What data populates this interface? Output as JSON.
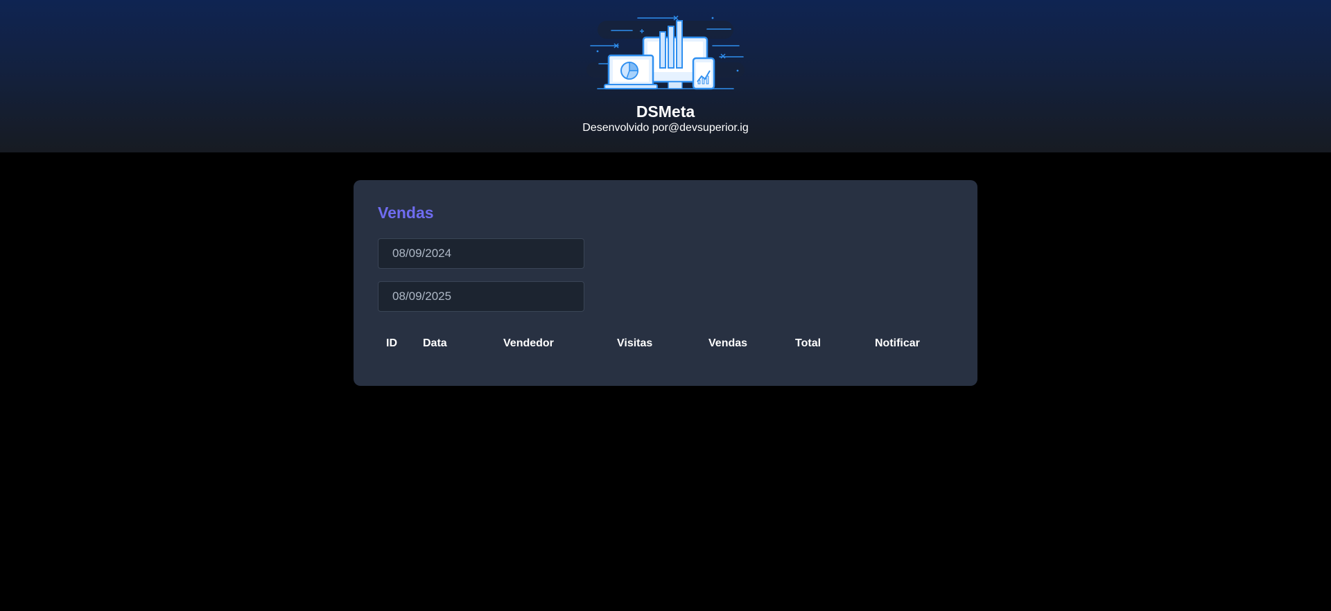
{
  "header": {
    "logo_icon": "dashboard-illustration-icon",
    "title": "DSMeta",
    "subtitle": "Desenvolvido por@devsuperior.ig"
  },
  "sales": {
    "title": "Vendas",
    "min_date": "08/09/2024",
    "max_date": "08/09/2025",
    "columns": [
      "ID",
      "Data",
      "Vendedor",
      "Visitas",
      "Vendas",
      "Total",
      "Notificar"
    ],
    "rows": []
  },
  "colors": {
    "accent": "#6f6cf0",
    "card_background": "#283142",
    "page_background": "#000000",
    "header_top": "#0f2452",
    "header_bottom": "#171b22",
    "icon_blue": "#2f8ff0"
  }
}
